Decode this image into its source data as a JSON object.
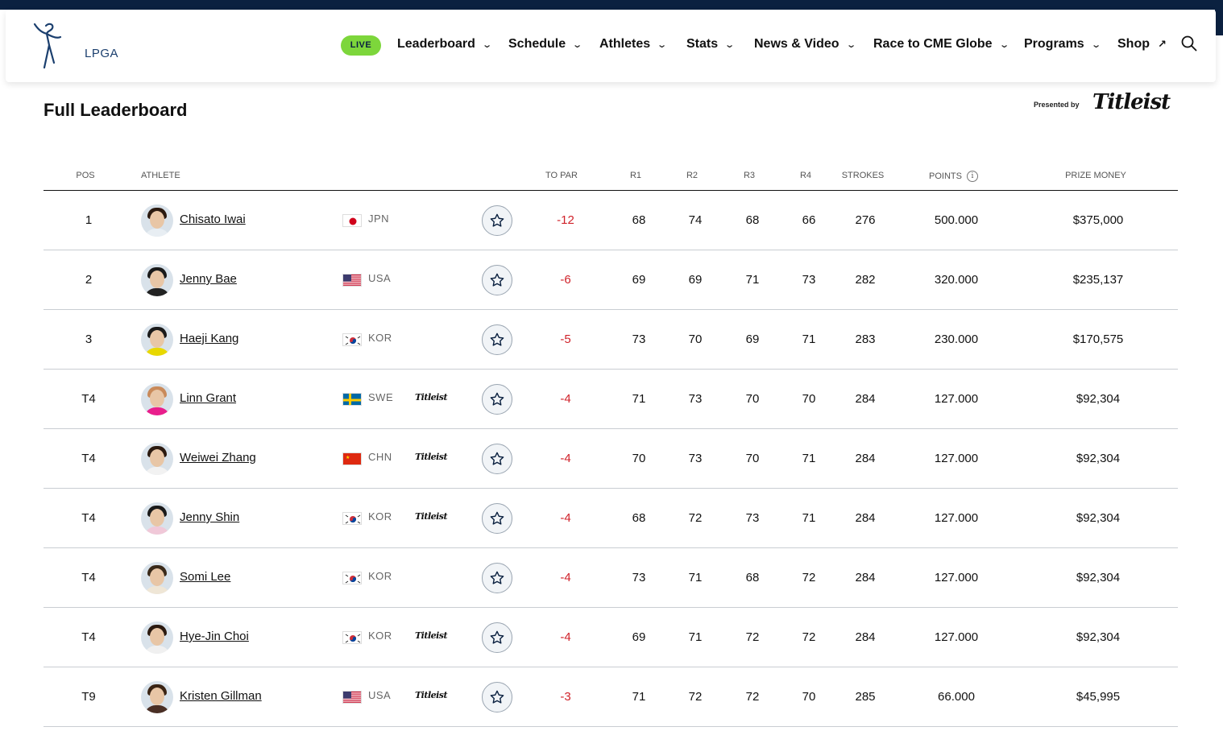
{
  "header": {
    "logo_text": "LPGA",
    "live_label": "LIVE",
    "nav": [
      {
        "label": "Leaderboard"
      },
      {
        "label": "Schedule"
      },
      {
        "label": "Athletes"
      },
      {
        "label": "Stats"
      },
      {
        "label": "News & Video"
      },
      {
        "label": "Race to CME Globe"
      },
      {
        "label": "Programs"
      },
      {
        "label": "Shop"
      }
    ],
    "live_color": "#7dd63b",
    "bar_color": "#0b2140"
  },
  "page": {
    "title": "Full Leaderboard",
    "presented_by": "Presented by",
    "sponsor": "Titleist"
  },
  "table": {
    "headers": {
      "pos": "POS",
      "athlete": "ATHLETE",
      "to_par": "TO PAR",
      "r1": "R1",
      "r2": "R2",
      "r3": "R3",
      "r4": "R4",
      "strokes": "STROKES",
      "points": "POINTS",
      "prize": "PRIZE MONEY"
    },
    "rows": [
      {
        "pos": "1",
        "name": "Chisato Iwai",
        "country": "JPN",
        "flag": "jpn",
        "sponsor": "",
        "to_par": "-12",
        "r1": "68",
        "r2": "74",
        "r3": "68",
        "r4": "66",
        "strokes": "276",
        "points": "500.000",
        "prize": "$375,000"
      },
      {
        "pos": "2",
        "name": "Jenny Bae",
        "country": "USA",
        "flag": "usa",
        "sponsor": "",
        "to_par": "-6",
        "r1": "69",
        "r2": "69",
        "r3": "71",
        "r4": "73",
        "strokes": "282",
        "points": "320.000",
        "prize": "$235,137"
      },
      {
        "pos": "3",
        "name": "Haeji Kang",
        "country": "KOR",
        "flag": "kor",
        "sponsor": "",
        "to_par": "-5",
        "r1": "73",
        "r2": "70",
        "r3": "69",
        "r4": "71",
        "strokes": "283",
        "points": "230.000",
        "prize": "$170,575"
      },
      {
        "pos": "T4",
        "name": "Linn Grant",
        "country": "SWE",
        "flag": "swe",
        "sponsor": "Titleist",
        "to_par": "-4",
        "r1": "71",
        "r2": "73",
        "r3": "70",
        "r4": "70",
        "strokes": "284",
        "points": "127.000",
        "prize": "$92,304"
      },
      {
        "pos": "T4",
        "name": "Weiwei Zhang",
        "country": "CHN",
        "flag": "chn",
        "sponsor": "Titleist",
        "to_par": "-4",
        "r1": "70",
        "r2": "73",
        "r3": "70",
        "r4": "71",
        "strokes": "284",
        "points": "127.000",
        "prize": "$92,304"
      },
      {
        "pos": "T4",
        "name": "Jenny Shin",
        "country": "KOR",
        "flag": "kor",
        "sponsor": "Titleist",
        "to_par": "-4",
        "r1": "68",
        "r2": "72",
        "r3": "73",
        "r4": "71",
        "strokes": "284",
        "points": "127.000",
        "prize": "$92,304"
      },
      {
        "pos": "T4",
        "name": "Somi Lee",
        "country": "KOR",
        "flag": "kor",
        "sponsor": "",
        "to_par": "-4",
        "r1": "73",
        "r2": "71",
        "r3": "68",
        "r4": "72",
        "strokes": "284",
        "points": "127.000",
        "prize": "$92,304"
      },
      {
        "pos": "T4",
        "name": "Hye-Jin Choi",
        "country": "KOR",
        "flag": "kor",
        "sponsor": "Titleist",
        "to_par": "-4",
        "r1": "69",
        "r2": "71",
        "r3": "72",
        "r4": "72",
        "strokes": "284",
        "points": "127.000",
        "prize": "$92,304"
      },
      {
        "pos": "T9",
        "name": "Kristen Gillman",
        "country": "USA",
        "flag": "usa",
        "sponsor": "Titleist",
        "to_par": "-3",
        "r1": "71",
        "r2": "72",
        "r3": "72",
        "r4": "70",
        "strokes": "285",
        "points": "66.000",
        "prize": "$45,995"
      }
    ]
  },
  "icons": {
    "search": "search-icon",
    "favorite": "star-icon",
    "info": "info-icon",
    "chevron": "chevron-down-icon",
    "external": "external-link-icon"
  }
}
